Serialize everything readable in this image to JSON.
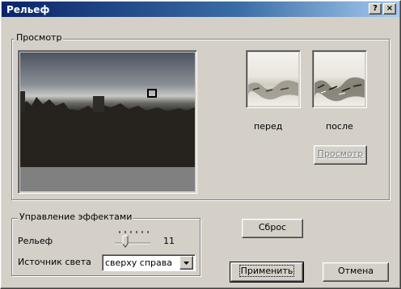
{
  "window": {
    "title": "Рельеф",
    "help_button": "?",
    "close_button": "×"
  },
  "preview_group": {
    "label": "Просмотр",
    "before_label": "перед",
    "after_label": "после",
    "preview_button": "Просмотр"
  },
  "effects_group": {
    "label": "Управление эффектами",
    "relief_label": "Рельеф",
    "relief_value": "11",
    "light_source_label": "Источник света",
    "light_source_value": "сверху справа"
  },
  "buttons": {
    "reset": "Сброс",
    "apply": "Применить",
    "cancel": "Отмена"
  },
  "colors": {
    "titlebar_start": "#0a246a",
    "titlebar_end": "#a6caf0",
    "face": "#d4d0c8"
  }
}
